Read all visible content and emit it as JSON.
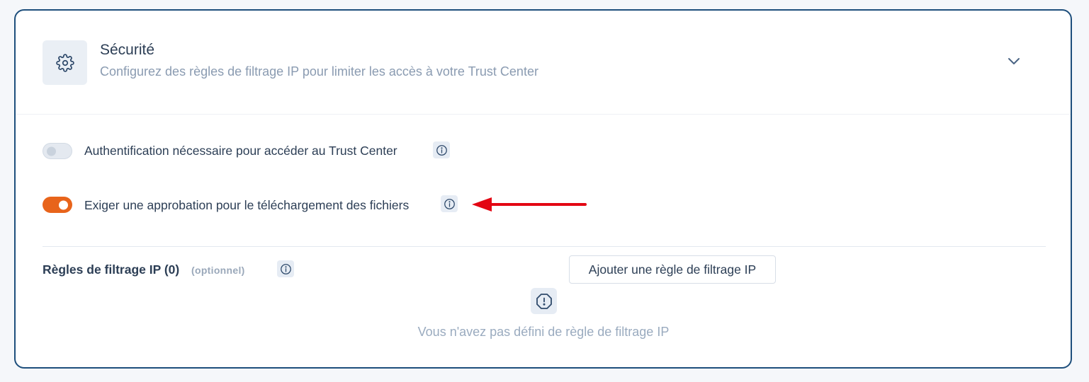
{
  "section": {
    "title": "Sécurité",
    "subtitle": "Configurez des règles de filtrage IP pour limiter les accès à votre Trust Center",
    "icon": "gear-icon",
    "expand_icon": "chevron-down-icon"
  },
  "options": [
    {
      "label": "Authentification nécessaire pour accéder au Trust Center",
      "enabled": false,
      "info_icon": "info-icon"
    },
    {
      "label": "Exiger une approbation pour le téléchargement des fichiers",
      "enabled": true,
      "info_icon": "info-icon"
    }
  ],
  "ip_rules": {
    "label": "Règles de filtrage IP (0)",
    "optional": "(optionnel)",
    "add_button": "Ajouter une règle de filtrage IP",
    "empty_message": "Vous n'avez pas défini de règle de filtrage IP",
    "empty_icon": "alert-circle-icon"
  },
  "colors": {
    "border": "#1e4f7c",
    "accent": "#e8641b",
    "arrow": "#e30613",
    "text": "#2c3e55",
    "muted": "#8a9bb1"
  }
}
